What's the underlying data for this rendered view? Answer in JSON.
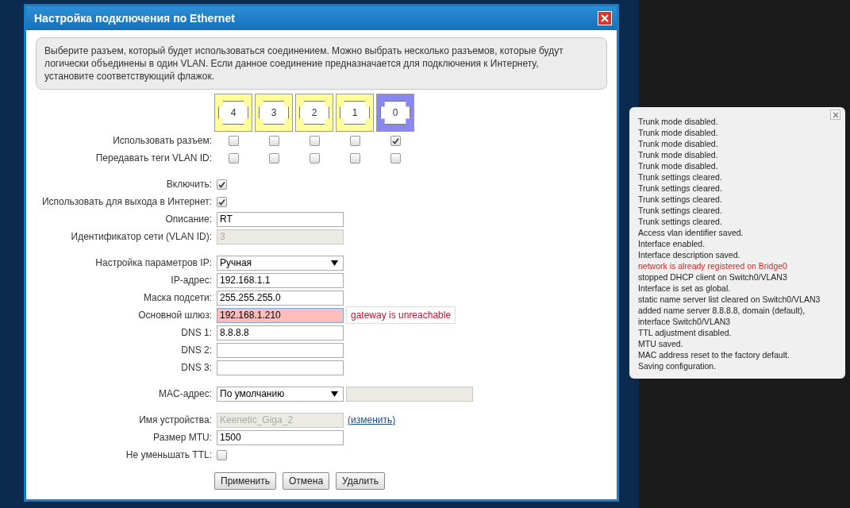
{
  "dialog": {
    "title": "Настройка подключения по Ethernet"
  },
  "intro": "Выберите разъем, который будет использоваться соединением. Можно выбрать несколько разъемов, которые будут логически объединены в один VLAN. Если данное соединение предназначается для подключения к Интернету, установите соответствующий флажок.",
  "ports": [
    {
      "label": "4",
      "selected": false
    },
    {
      "label": "3",
      "selected": false
    },
    {
      "label": "2",
      "selected": false
    },
    {
      "label": "1",
      "selected": false
    },
    {
      "label": "0",
      "selected": true
    }
  ],
  "port_rows": [
    {
      "label": "Использовать разъем:",
      "checks": [
        false,
        false,
        false,
        false,
        true
      ]
    },
    {
      "label": "Передавать теги VLAN ID:",
      "checks": [
        false,
        false,
        false,
        false,
        false
      ]
    }
  ],
  "groups": [
    {
      "fields": [
        {
          "kind": "checkbox",
          "label": "Включить:",
          "checked": true
        },
        {
          "kind": "checkbox",
          "label": "Использовать для выхода в Интернет:",
          "checked": true
        },
        {
          "kind": "text",
          "label": "Описание:",
          "value": "RT"
        },
        {
          "kind": "readonly",
          "label": "Идентификатор сети (VLAN ID):",
          "value": "3"
        }
      ]
    },
    {
      "fields": [
        {
          "kind": "select",
          "label": "Настройка параметров IP:",
          "value": "Ручная"
        },
        {
          "kind": "text",
          "label": "IP-адрес:",
          "value": "192.168.1.1"
        },
        {
          "kind": "text",
          "label": "Маска подсети:",
          "value": "255.255.255.0"
        },
        {
          "kind": "text",
          "label": "Основной шлюз:",
          "value": "192.168.1.210",
          "error": "gateway is unreachable"
        },
        {
          "kind": "text",
          "label": "DNS 1:",
          "value": "8.8.8.8"
        },
        {
          "kind": "text",
          "label": "DNS 2:"
        },
        {
          "kind": "text",
          "label": "DNS 3:"
        }
      ]
    },
    {
      "fields": [
        {
          "kind": "select_field",
          "label": "MAC-адрес:",
          "value": "По умолчанию"
        }
      ]
    },
    {
      "fields": [
        {
          "kind": "readonly",
          "label": "Имя устройства:",
          "value": "Keenetic_Giga_2",
          "link": "(изменить)"
        },
        {
          "kind": "text",
          "label": "Размер MTU:",
          "value": "1500"
        },
        {
          "kind": "checkbox",
          "label": "Не уменьшать TTL:",
          "checked": false
        }
      ]
    }
  ],
  "buttons": [
    "Применить",
    "Отмена",
    "Удалить"
  ],
  "log": [
    {
      "text": "Trunk mode disabled.",
      "kind": "info"
    },
    {
      "text": "Trunk mode disabled.",
      "kind": "info"
    },
    {
      "text": "Trunk mode disabled.",
      "kind": "info"
    },
    {
      "text": "Trunk mode disabled.",
      "kind": "info"
    },
    {
      "text": "Trunk mode disabled.",
      "kind": "info"
    },
    {
      "text": "Trunk settings cleared.",
      "kind": "info"
    },
    {
      "text": "Trunk settings cleared.",
      "kind": "info"
    },
    {
      "text": "Trunk settings cleared.",
      "kind": "info"
    },
    {
      "text": "Trunk settings cleared.",
      "kind": "info"
    },
    {
      "text": "Trunk settings cleared.",
      "kind": "info"
    },
    {
      "text": "Access vlan identifier saved.",
      "kind": "info"
    },
    {
      "text": "Interface enabled.",
      "kind": "info"
    },
    {
      "text": "Interface description saved.",
      "kind": "info"
    },
    {
      "text": "network is already registered on Bridge0",
      "kind": "error"
    },
    {
      "text": "stopped DHCP client on Switch0/VLAN3",
      "kind": "info"
    },
    {
      "text": "Interface is set as global.",
      "kind": "info"
    },
    {
      "text": "static name server list cleared on Switch0/VLAN3",
      "kind": "info"
    },
    {
      "text": "added name server 8.8.8.8, domain (default),",
      "kind": "info"
    },
    {
      "text": "interface Switch0/VLAN3",
      "kind": "info"
    },
    {
      "text": "TTL adjustment disabled.",
      "kind": "info"
    },
    {
      "text": "MTU saved.",
      "kind": "info"
    },
    {
      "text": "MAC address reset to the factory default.",
      "kind": "info"
    },
    {
      "text": "Saving configuration.",
      "kind": "info"
    }
  ]
}
